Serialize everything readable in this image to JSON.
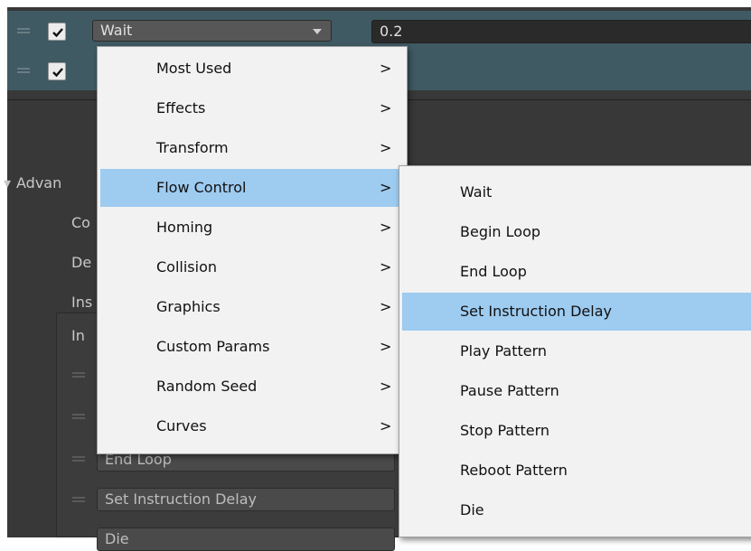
{
  "rows": [
    {
      "checked": true,
      "type": "Wait",
      "value": "0.2"
    },
    {
      "checked": true
    }
  ],
  "section_title": "Advan",
  "partial_labels": [
    "Co",
    "De",
    "Ins",
    "In"
  ],
  "list_items": [
    "End Loop",
    "Set Instruction Delay",
    "Die"
  ],
  "menu": {
    "items": [
      {
        "label": "Most Used",
        "arrow": ">"
      },
      {
        "label": "Effects",
        "arrow": ">"
      },
      {
        "label": "Transform",
        "arrow": ">"
      },
      {
        "label": "Flow Control",
        "arrow": ">",
        "highlighted": true
      },
      {
        "label": "Homing",
        "arrow": ">"
      },
      {
        "label": "Collision",
        "arrow": ">"
      },
      {
        "label": "Graphics",
        "arrow": ">"
      },
      {
        "label": "Custom Params",
        "arrow": ">"
      },
      {
        "label": "Random Seed",
        "arrow": ">"
      },
      {
        "label": "Curves",
        "arrow": ">"
      }
    ]
  },
  "submenu": {
    "items": [
      {
        "label": "Wait"
      },
      {
        "label": "Begin Loop"
      },
      {
        "label": "End Loop"
      },
      {
        "label": "Set Instruction Delay",
        "highlighted": true
      },
      {
        "label": "Play Pattern"
      },
      {
        "label": "Pause Pattern"
      },
      {
        "label": "Stop Pattern"
      },
      {
        "label": "Reboot Pattern"
      },
      {
        "label": "Die"
      }
    ]
  },
  "colors": {
    "menu_highlight": "#9ecbf0",
    "menu_background": "#f2f2f2",
    "editor_background": "#383838",
    "selected_row": "#3f5a63"
  }
}
